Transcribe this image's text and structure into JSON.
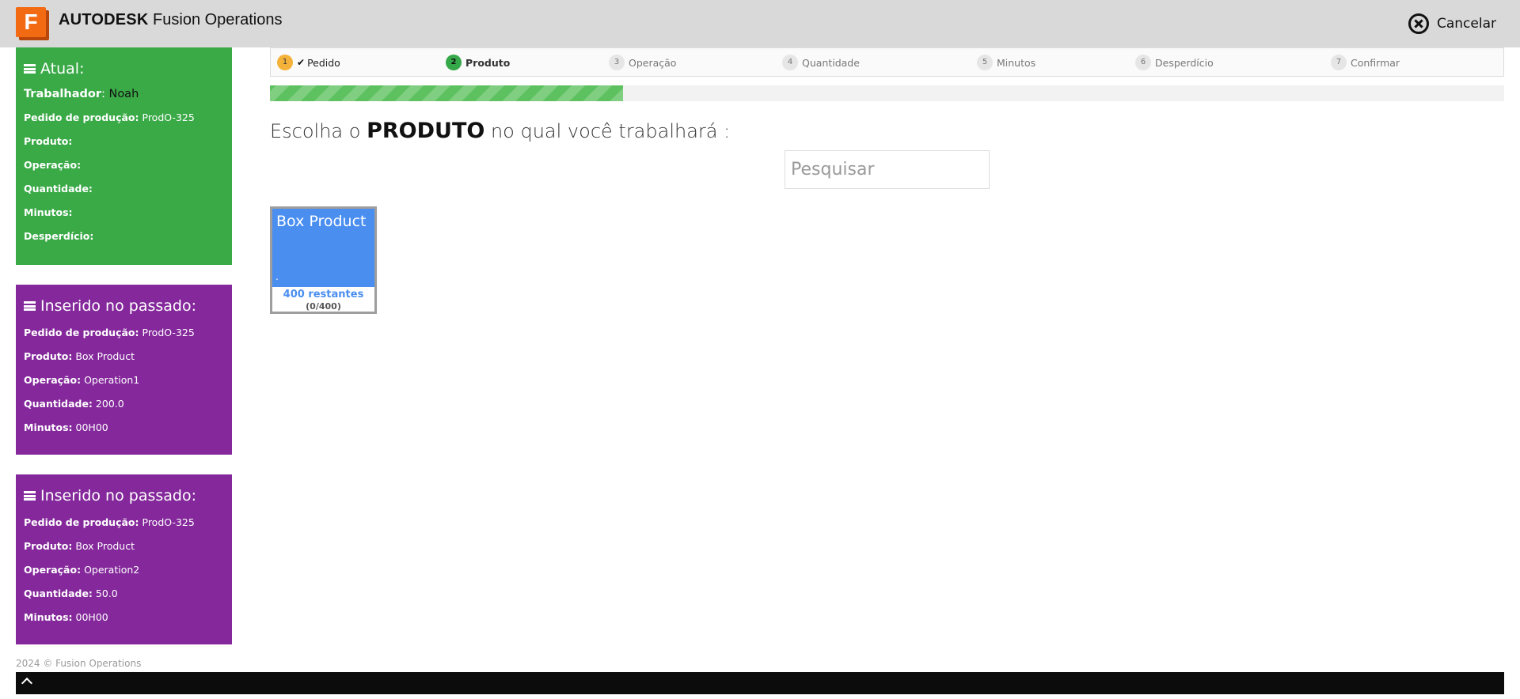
{
  "header": {
    "logo_letter": "F",
    "brand_bold": "AUTODESK",
    "brand_rest": "Fusion Operations",
    "cancel_label": "Cancelar"
  },
  "current": {
    "title": "Atual:",
    "worker_label": "Trabalhador",
    "worker_sep": ":",
    "worker_value": "Noah",
    "rows": [
      {
        "label": "Pedido de produção:",
        "value": "ProdO-325"
      },
      {
        "label": "Produto:",
        "value": ""
      },
      {
        "label": "Operação:",
        "value": ""
      },
      {
        "label": "Quantidade:",
        "value": ""
      },
      {
        "label": "Minutos:",
        "value": ""
      },
      {
        "label": "Desperdício:",
        "value": ""
      }
    ]
  },
  "past": [
    {
      "title": "Inserido no passado:",
      "rows": [
        {
          "label": "Pedido de produção:",
          "value": "ProdO-325"
        },
        {
          "label": "Produto:",
          "value": "Box Product"
        },
        {
          "label": "Operação:",
          "value": "Operation1"
        },
        {
          "label": "Quantidade:",
          "value": "200.0"
        },
        {
          "label": "Minutos:",
          "value": "00H00"
        }
      ]
    },
    {
      "title": "Inserido no passado:",
      "rows": [
        {
          "label": "Pedido de produção:",
          "value": "ProdO-325"
        },
        {
          "label": "Produto:",
          "value": "Box Product"
        },
        {
          "label": "Operação:",
          "value": "Operation2"
        },
        {
          "label": "Quantidade:",
          "value": "50.0"
        },
        {
          "label": "Minutos:",
          "value": "00H00"
        }
      ]
    }
  ],
  "steps": [
    {
      "num": "1",
      "label": "Pedido",
      "state": "done"
    },
    {
      "num": "2",
      "label": "Produto",
      "state": "active"
    },
    {
      "num": "3",
      "label": "Operação",
      "state": "pending"
    },
    {
      "num": "4",
      "label": "Quantidade",
      "state": "pending"
    },
    {
      "num": "5",
      "label": "Minutos",
      "state": "pending"
    },
    {
      "num": "6",
      "label": "Desperdício",
      "state": "pending"
    },
    {
      "num": "7",
      "label": "Confirmar",
      "state": "pending"
    }
  ],
  "progress_fraction": 0.286,
  "prompt": {
    "before": "Escolha o ",
    "emph": "PRODUTO",
    "after": " no qual você trabalhará :"
  },
  "search": {
    "placeholder": "Pesquisar",
    "value": ""
  },
  "products": [
    {
      "name": "Box Product",
      "dot": ".",
      "remaining": "400 restantes",
      "count": "(0/400)"
    }
  ],
  "footer": {
    "copyright": "2024 © Fusion Operations"
  },
  "colors": {
    "green_panel": "#3aaa47",
    "purple_panel": "#84289b",
    "card_blue": "#4a8ef0",
    "progress_green": "#5cc15e",
    "step_done": "#f4b23a",
    "step_active": "#35a84a"
  }
}
